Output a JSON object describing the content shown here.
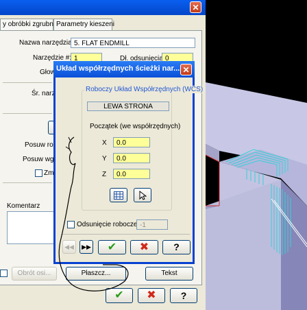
{
  "back_dialog": {
    "tabs": [
      "y obróbki zgrubnej",
      "Parametry kieszeni"
    ],
    "tool_name_label": "Nazwa narzędzia:",
    "tool_name_value": "5. FLAT ENDMILL",
    "tool_number_label": "Narzędzie #:",
    "tool_number_value": "1",
    "offset_label": "Dł. odsunięcia:",
    "offset_value": "0",
    "head_label": "Głow",
    "diameter_label": "Śr. narzę",
    "feed_label": "Posuw robo",
    "plunge_label": "Posuw wgłę",
    "change_label": "Zmi",
    "comment_label": "Komentarz",
    "rotate_button": "Obrót osi...",
    "plane_button": "Płaszcz...",
    "text_button": "Tekst"
  },
  "front_dialog": {
    "title": "Układ współrzędnych ścieżki nar...",
    "group_title": "Roboczy Układ Współrzędnych (WCS)",
    "wcs_name": "LEWA STRONA",
    "origin_label": "Początek (we współrzędnych)",
    "x_label": "X",
    "x_value": "0.0",
    "y_label": "Y",
    "y_value": "0.0",
    "z_label": "Z",
    "z_value": "0.0",
    "offset_checkbox_label": "Odsunięcie robocze",
    "offset_value": "-1"
  },
  "colors": {
    "title_bar": "#0b4fd8",
    "dialog_bg": "#ece9d8",
    "field_highlight": "#ffff99",
    "ok_green": "#2a9a1a",
    "cancel_red": "#d0281a",
    "viewport_bg": "#000000"
  }
}
